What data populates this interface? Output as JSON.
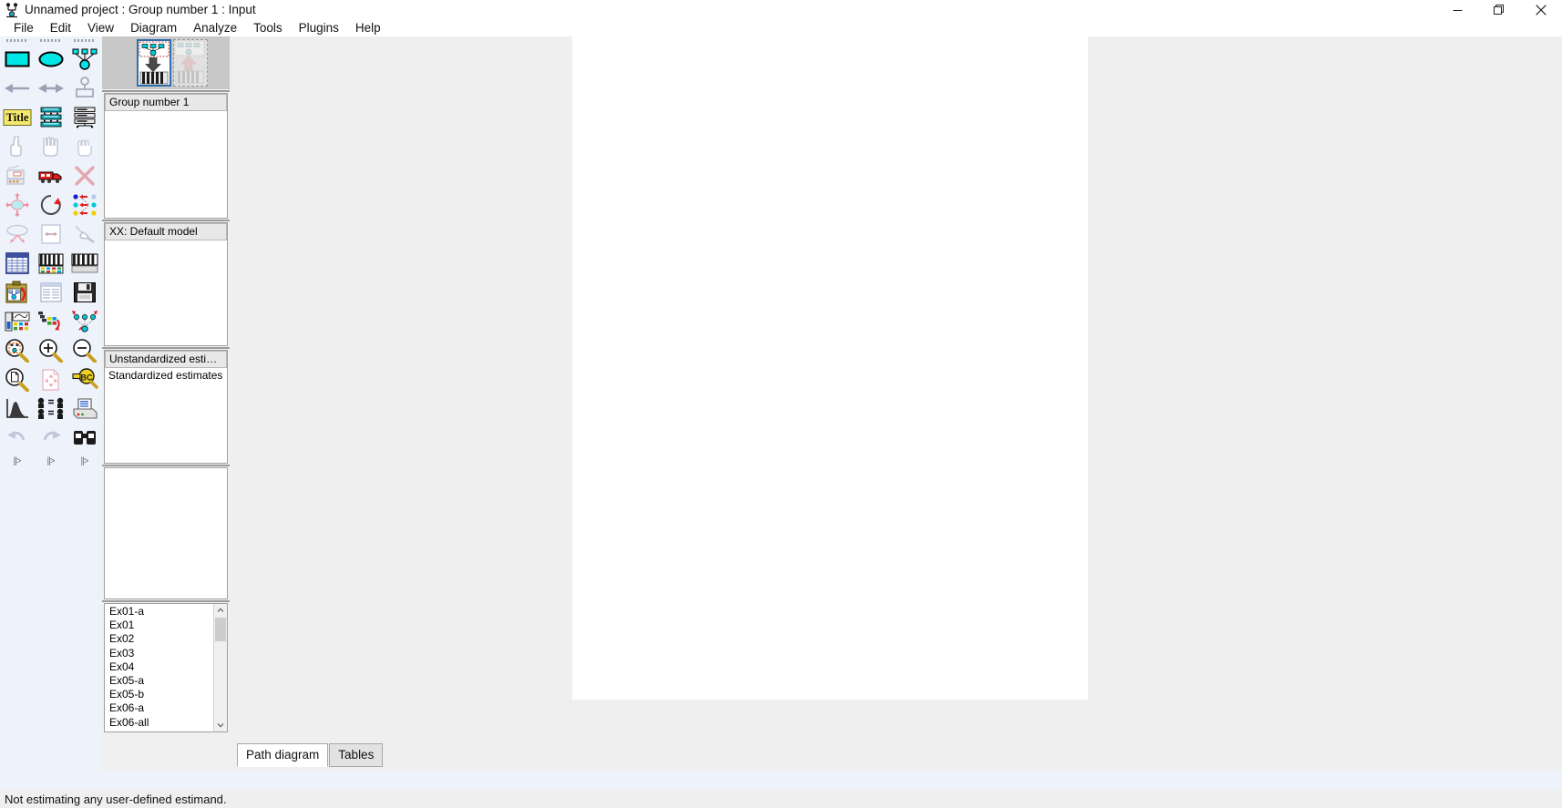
{
  "window": {
    "title": "Unnamed project : Group number 1 : Input",
    "app_icon": "amos-icon",
    "buttons": {
      "minimize": "minimize-button",
      "maximize": "maximize-button",
      "close": "close-button"
    }
  },
  "menubar": {
    "items": [
      {
        "label": "File"
      },
      {
        "label": "Edit"
      },
      {
        "label": "View"
      },
      {
        "label": "Diagram"
      },
      {
        "label": "Analyze"
      },
      {
        "label": "Tools"
      },
      {
        "label": "Plugins"
      },
      {
        "label": "Help"
      }
    ]
  },
  "toolbox": {
    "tools": [
      {
        "name": "draw-observed-variable-icon",
        "title": "Draw observed variables"
      },
      {
        "name": "draw-unobserved-variable-icon",
        "title": "Draw unobserved variables"
      },
      {
        "name": "draw-latent-variable-icon",
        "title": "Draw a latent variable or add an indicator to a latent variable"
      },
      {
        "name": "draw-path-icon",
        "title": "Draw paths (single headed arrows)"
      },
      {
        "name": "draw-covariance-icon",
        "title": "Draw covariances (double headed arrows)"
      },
      {
        "name": "add-unique-variable-icon",
        "title": "Add a unique variable to an existing variable"
      },
      {
        "name": "figure-caption-icon",
        "title": "Figure caption"
      },
      {
        "name": "list-variables-in-model-icon",
        "title": "List variables in model"
      },
      {
        "name": "list-variables-in-dataset-icon",
        "title": "List variables in dataset"
      },
      {
        "name": "select-one-object-icon",
        "title": "Select one object at a time"
      },
      {
        "name": "select-all-objects-icon",
        "title": "Select all objects"
      },
      {
        "name": "deselect-all-objects-icon",
        "title": "Deselect all objects"
      },
      {
        "name": "duplicate-objects-icon",
        "title": "Duplicate objects"
      },
      {
        "name": "move-objects-icon",
        "title": "Move objects"
      },
      {
        "name": "erase-objects-icon",
        "title": "Erase objects"
      },
      {
        "name": "change-shape-icon",
        "title": "Change the shape of objects"
      },
      {
        "name": "rotate-indicators-icon",
        "title": "Rotate the indicators of a latent variable"
      },
      {
        "name": "reflect-indicators-icon",
        "title": "Reflect the indicators of a latent variable"
      },
      {
        "name": "move-parameter-icon",
        "title": "Move parameter values"
      },
      {
        "name": "scroll-diagram-icon",
        "title": "Reposition path diagram on the screen"
      },
      {
        "name": "touch-up-variable-icon",
        "title": "Touch up a variable"
      },
      {
        "name": "select-data-file-icon",
        "title": "Select data file(s)"
      },
      {
        "name": "analysis-properties-icon",
        "title": "Analysis properties"
      },
      {
        "name": "object-properties-icon",
        "title": "Object properties"
      },
      {
        "name": "calculate-estimates-icon",
        "title": "Calculate estimates"
      },
      {
        "name": "copy-to-clipboard-icon",
        "title": "Copy the path diagram to the clipboard"
      },
      {
        "name": "view-text-output-icon",
        "title": "View text output"
      },
      {
        "name": "save-diagram-icon",
        "title": "Save the current path diagram"
      },
      {
        "name": "object-properties-2-icon",
        "title": "Object properties"
      },
      {
        "name": "drag-properties-icon",
        "title": "Drag properties from object to object"
      },
      {
        "name": "preserve-symmetries-icon",
        "title": "Preserve symmetries"
      },
      {
        "name": "zoom-selection-icon",
        "title": "Zoom in on an area that you select"
      },
      {
        "name": "zoom-in-icon",
        "title": "Zoom in"
      },
      {
        "name": "zoom-out-icon",
        "title": "Zoom out"
      },
      {
        "name": "zoom-page-icon",
        "title": "Show the entire page on the screen"
      },
      {
        "name": "resize-to-page-icon",
        "title": "Resize the path diagram to fit on a page"
      },
      {
        "name": "loupe-icon",
        "title": "Magnify (loupe)"
      },
      {
        "name": "bayesian-estimation-icon",
        "title": "Bayesian estimation"
      },
      {
        "name": "multiple-group-analysis-icon",
        "title": "Multiple group analysis"
      },
      {
        "name": "print-icon",
        "title": "Print the selected path diagrams"
      },
      {
        "name": "undo-icon",
        "title": "Undo the previous change"
      },
      {
        "name": "redo-icon",
        "title": "Redo the previous change"
      },
      {
        "name": "specification-search-icon",
        "title": "Specification search"
      }
    ]
  },
  "panels": {
    "view_icons": [
      {
        "name": "view-input-path-diagram-icon",
        "selected": true
      },
      {
        "name": "view-output-path-diagram-icon",
        "selected": false
      }
    ],
    "groups": {
      "items": [
        {
          "label": "Group number 1",
          "selected": true
        }
      ]
    },
    "models": {
      "items": [
        {
          "label": "XX: Default model",
          "selected": true
        }
      ]
    },
    "estimates": {
      "items": [
        {
          "label": "Unstandardized estimates",
          "selected": true
        },
        {
          "label": "Standardized estimates",
          "selected": false
        }
      ]
    },
    "fit_measures": {
      "items": []
    },
    "files": {
      "items": [
        {
          "label": "Ex01-a"
        },
        {
          "label": "Ex01"
        },
        {
          "label": "Ex02"
        },
        {
          "label": "Ex03"
        },
        {
          "label": "Ex04"
        },
        {
          "label": "Ex05-a"
        },
        {
          "label": "Ex05-b"
        },
        {
          "label": "Ex06-a"
        },
        {
          "label": "Ex06-all"
        }
      ]
    }
  },
  "workspace": {
    "tabs": [
      {
        "label": "Path diagram",
        "active": true
      },
      {
        "label": "Tables",
        "active": false
      }
    ]
  },
  "statusbar": {
    "message": "Not estimating any user-defined estimand."
  },
  "colors": {
    "accent": "#2f6fad",
    "cyan": "#00e5e5",
    "title_yellow": "#f5e96b",
    "panel_bg": "#f0f0f0",
    "toolbox_bg": "#eef2fa",
    "canvas_bg": "#efefef"
  }
}
